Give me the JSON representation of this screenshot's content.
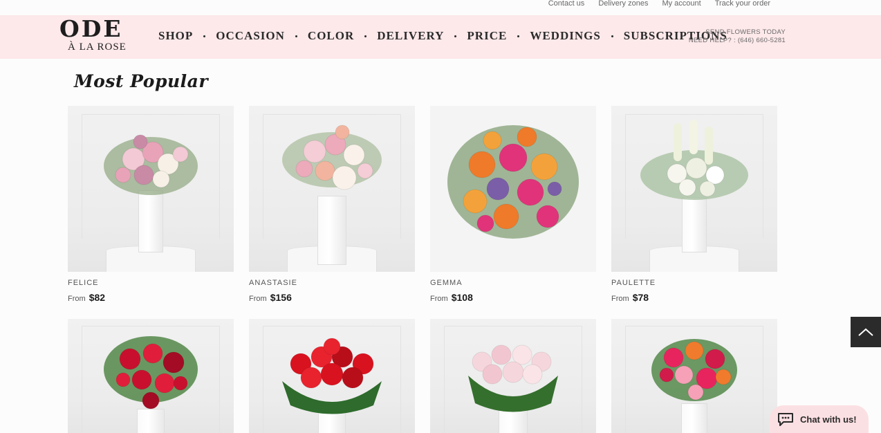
{
  "utility_links": [
    "Contact us",
    "Delivery zones",
    "My account",
    "Track your order"
  ],
  "logo": {
    "main": "ODE",
    "sub": "À LA ROSE"
  },
  "nav": [
    "SHOP",
    "OCCASION",
    "COLOR",
    "DELIVERY",
    "PRICE",
    "WEDDINGS",
    "SUBSCRIPTIONS"
  ],
  "help": {
    "line1": "SEND FLOWERS TODAY",
    "line2": "NEED HELP? : (646) 660-5281"
  },
  "section_title": "Most Popular",
  "products": [
    {
      "name": "FELICE",
      "from": "From",
      "price": "$82",
      "colors": [
        "#f2c9d4",
        "#e8a3b8",
        "#f7f0e6",
        "#c98aa6"
      ]
    },
    {
      "name": "ANASTASIE",
      "from": "From",
      "price": "$156",
      "colors": [
        "#f4cdd6",
        "#ecaabb",
        "#faf2ea",
        "#f2b49e"
      ]
    },
    {
      "name": "GEMMA",
      "from": "From",
      "price": "$108",
      "colors": [
        "#ef7a2a",
        "#e0337a",
        "#f3a23b",
        "#7b5ea8"
      ]
    },
    {
      "name": "PAULETTE",
      "from": "From",
      "price": "$78",
      "colors": [
        "#f6f6ee",
        "#eef0e2",
        "#9fb89a",
        "#ffffff"
      ]
    },
    {
      "name": "",
      "from": "",
      "price": "",
      "colors": [
        "#c8102e",
        "#e01e3c",
        "#a30c24",
        "#2f6b2a"
      ]
    },
    {
      "name": "",
      "from": "",
      "price": "",
      "colors": [
        "#d9121f",
        "#e8232e",
        "#b80e1a",
        "#2c6a2c"
      ]
    },
    {
      "name": "",
      "from": "",
      "price": "",
      "colors": [
        "#f6d6dd",
        "#f2c6d0",
        "#fae4e8",
        "#2f6b2a"
      ]
    },
    {
      "name": "",
      "from": "",
      "price": "",
      "colors": [
        "#e8245e",
        "#f07b2d",
        "#d11b4a",
        "#f6a1b8"
      ]
    }
  ],
  "chat_label": "Chat with us!"
}
